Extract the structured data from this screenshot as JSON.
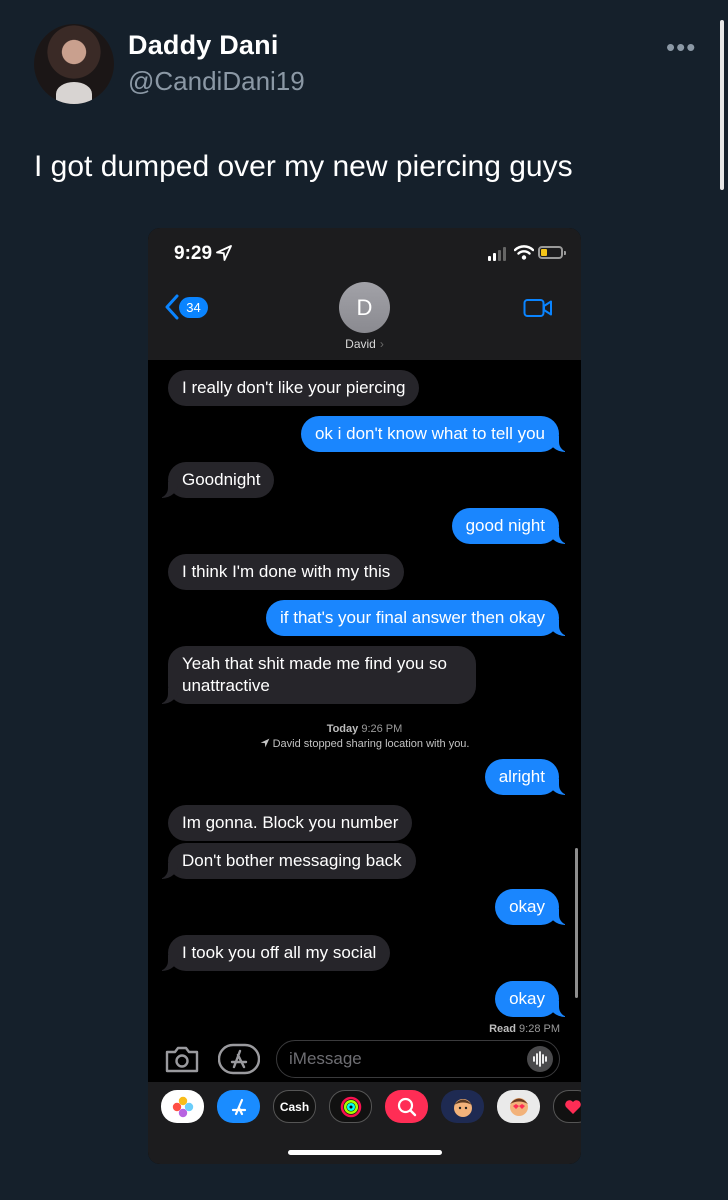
{
  "tweet": {
    "display_name": "Daddy Dani",
    "handle": "@CandiDani19",
    "more_glyph": "•••",
    "text": "I got dumped over my new piercing guys"
  },
  "phone": {
    "status_bar": {
      "time": "9:29",
      "battery_color": "#f5c518"
    },
    "header": {
      "back_count": "34",
      "avatar_initial": "D",
      "contact_name": "David",
      "contact_chevron": "›"
    },
    "messages": [
      {
        "from": "them",
        "text": "I really don't like your piercing"
      },
      {
        "from": "me",
        "text": "ok i don't know what to tell you"
      },
      {
        "from": "them",
        "text": "Goodnight"
      },
      {
        "from": "me",
        "text": "good night"
      },
      {
        "from": "them",
        "text": "I think I'm done with my this"
      },
      {
        "from": "me",
        "text": "if that's your final answer then okay"
      },
      {
        "from": "them",
        "text": "Yeah that shit made me find you so unattractive"
      },
      {
        "from": "me",
        "text": "alright"
      },
      {
        "from": "them",
        "text": "Im gonna. Block you number"
      },
      {
        "from": "them",
        "text": "Don't bother messaging back"
      },
      {
        "from": "me",
        "text": "okay"
      },
      {
        "from": "them",
        "text": "I took you off all my social"
      },
      {
        "from": "me",
        "text": "okay"
      }
    ],
    "timestamp": {
      "day": "Today",
      "time": "9:26 PM"
    },
    "location_note": {
      "name": "David",
      "text": "stopped sharing location with you."
    },
    "read_receipt": {
      "label": "Read",
      "time": "9:28 PM"
    },
    "input": {
      "placeholder": "iMessage"
    },
    "app_strip": {
      "cash_label": "Cash"
    },
    "colors": {
      "outgoing": "#1a86fe",
      "incoming": "#26252a",
      "accent": "#0a84ff"
    }
  }
}
